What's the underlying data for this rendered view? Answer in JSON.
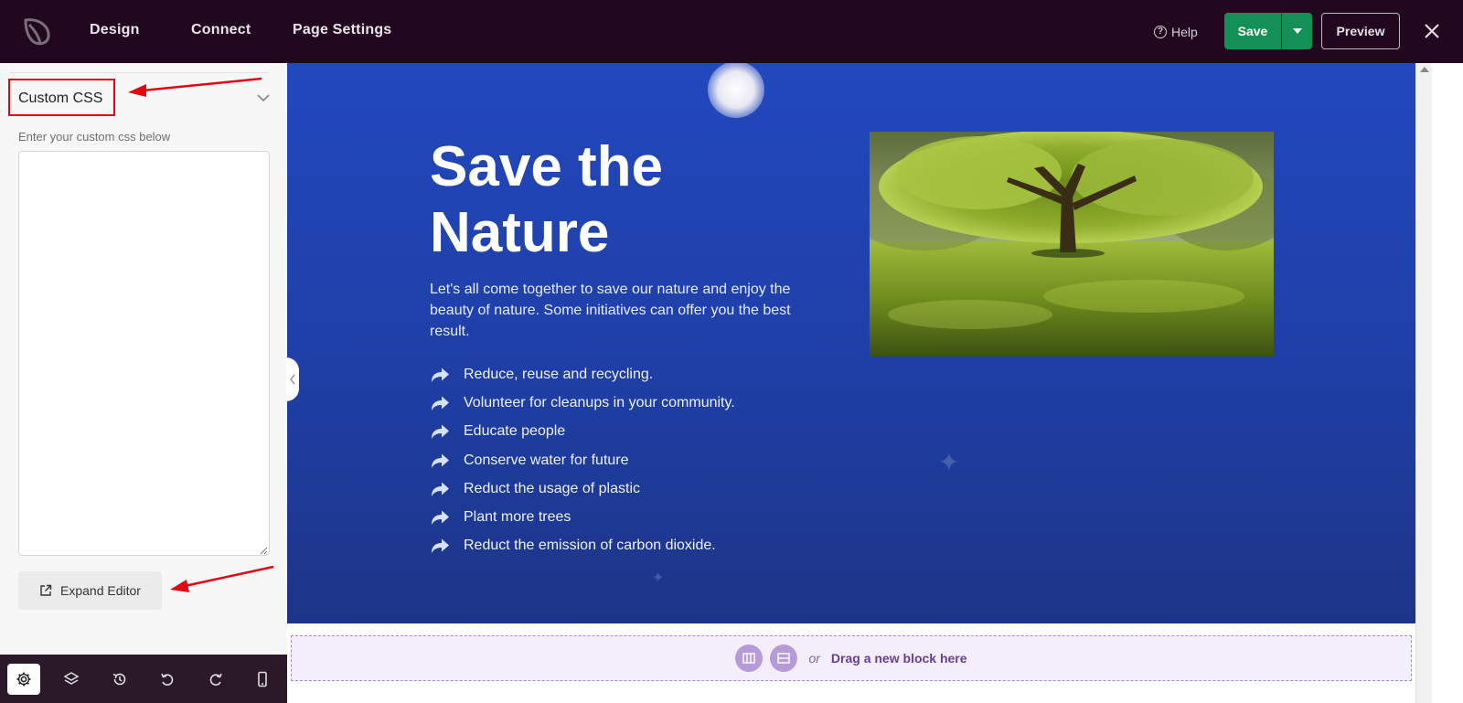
{
  "topbar": {
    "nav": [
      "Design",
      "Connect",
      "Page Settings"
    ],
    "help_label": "Help",
    "save_label": "Save",
    "preview_label": "Preview"
  },
  "sidebar": {
    "section_title": "Custom CSS",
    "helper_text": "Enter your custom css below",
    "css_value": "",
    "expand_label": "Expand Editor"
  },
  "hero": {
    "title": "Save the Nature",
    "description": "Let's all come together to save our nature and enjoy the beauty of nature. Some initiatives can offer you the best result.",
    "list": [
      "Reduce, reuse and recycling.",
      "Volunteer for cleanups in your community.",
      "Educate people",
      "Conserve water for future",
      "Reduct the usage of plastic",
      "Plant more trees",
      "Reduct the emission of carbon dioxide."
    ]
  },
  "drop_zone": {
    "or_text": "or",
    "cta": "Drag a new block here"
  },
  "colors": {
    "topbar_bg": "#22081f",
    "save_green": "#149056",
    "hero_blue": "#2248be",
    "annotation_red": "#e10613",
    "drop_zone_purple": "#6a3d9a"
  }
}
